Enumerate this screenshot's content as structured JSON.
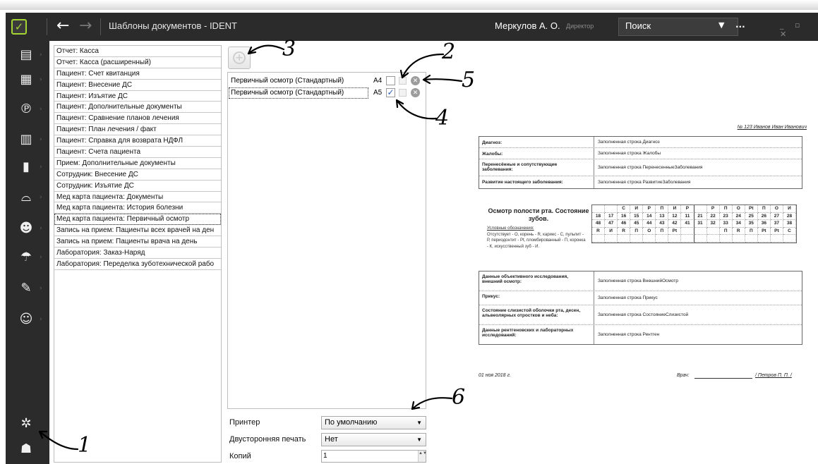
{
  "window": {
    "title": "Шаблоны документов - IDENT",
    "user_name": "Меркулов А. О.",
    "user_role": "Директор",
    "search_label": "Поиск",
    "search_more": "...",
    "logo_glyph": "✓",
    "back_glyph": "←",
    "forward_glyph": "→",
    "window_controls": "_ ▫ ✕"
  },
  "sidebar": {
    "items": [
      {
        "icon": "id-card-icon",
        "glyph": "▤"
      },
      {
        "icon": "calendar-icon",
        "glyph": "▦"
      },
      {
        "icon": "payment-icon",
        "glyph": "℗"
      },
      {
        "icon": "cash-register-icon",
        "glyph": "▥"
      },
      {
        "icon": "reports-chart-icon",
        "glyph": "▮"
      },
      {
        "icon": "tooth-icon",
        "glyph": "⌓"
      },
      {
        "icon": "users-icon",
        "glyph": "☻"
      },
      {
        "icon": "umbrella-icon",
        "glyph": "☂"
      },
      {
        "icon": "syringe-icon",
        "glyph": "✎"
      },
      {
        "icon": "patient-payment-icon",
        "glyph": "☺"
      }
    ],
    "settings_glyph": "✲",
    "profile_glyph": "☗"
  },
  "templates": [
    "Отчет: Касса",
    "Отчет: Касса (расширенный)",
    "Пациент: Счет квитанция",
    "Пациент: Внесение ДС",
    "Пациент: Изъятие ДС",
    "Пациент: Дополнительные документы",
    "Пациент: Сравнение планов лечения",
    "Пациент: План лечения / факт",
    "Пациент: Справка для возврата НДФЛ",
    "Пациент: Счета пациента",
    "Прием: Дополнительные документы",
    "Сотрудник: Внесение ДС",
    "Сотрудник: Изъятие ДС",
    "Мед карта пациента: Документы",
    "Мед карта пациента: История болезни",
    "Мед карта пациента: Первичный осмотр",
    "Запись на прием: Пациенты всех врачей на ден",
    "Запись на прием: Пациенты врача на день",
    "Лаборатория: Заказ-Наряд",
    "Лаборатория: Переделка зуботехнической рабо"
  ],
  "selected_template_index": 15,
  "add_icon_glyph": "+",
  "forms": [
    {
      "name": "Первичный осмотр (Стандартный)",
      "size": "A4",
      "checked": false,
      "check_glyph": "",
      "delete_glyph": "✕"
    },
    {
      "name": "Первичный осмотр (Стандартный)",
      "size": "A5",
      "checked": true,
      "check_glyph": "✓",
      "delete_glyph": "✕"
    }
  ],
  "options": {
    "printer_label": "Принтер",
    "printer_value": "По умолчанию",
    "duplex_label": "Двусторонняя печать",
    "duplex_value": "Нет",
    "copies_label": "Копий",
    "copies_value": "1",
    "arrow_glyph": "▼",
    "spin_glyph": "▲▼"
  },
  "annotations": [
    "1",
    "2",
    "3",
    "4",
    "5",
    "6"
  ],
  "preview": {
    "patient": "№ 123 Иванов Иван Иванович",
    "section1": [
      {
        "k": "Диагноз:",
        "v": "Заполненная строка Диагноз"
      },
      {
        "k": "Жалобы:",
        "v": "Заполненная строка Жалобы"
      },
      {
        "k": "Перенесённые и сопутствующие заболевания:",
        "v": "Заполненная строка ПеренесенныеЗаболевания"
      },
      {
        "k": "Развитие настоящего заболевания:",
        "v": "Заполненная строка РазвитиеЗаболевания"
      }
    ],
    "teeth_title": "Осмотр полости рта. Состояние зубов.",
    "teeth_legend_title": "Условные обозначения:",
    "teeth_legend": "Отсутствует - О, корень - R, кариес - С, пульпит - Р, периодонтит - Pt, пломбированный - П, коронка - К, искусственный зуб - И.",
    "teeth_rows": [
      [
        "",
        "",
        "С",
        "И",
        "Р",
        "П",
        "И",
        "Р",
        "",
        "Р",
        "П",
        "О",
        "Pt",
        "П",
        "О",
        "И"
      ],
      [
        "18",
        "17",
        "16",
        "15",
        "14",
        "13",
        "12",
        "11",
        "21",
        "22",
        "23",
        "24",
        "25",
        "26",
        "27",
        "28"
      ],
      [
        "48",
        "47",
        "46",
        "45",
        "44",
        "43",
        "42",
        "41",
        "31",
        "32",
        "33",
        "34",
        "35",
        "36",
        "37",
        "38"
      ],
      [
        "R",
        "И",
        "R",
        "П",
        "О",
        "П",
        "Pt",
        "",
        "",
        "",
        "П",
        "R",
        "П",
        "Pt",
        "Pt",
        "С"
      ],
      [
        "",
        "",
        "",
        "",
        "",
        "",
        "",
        "",
        "",
        "",
        "",
        "",
        "",
        "",
        "",
        ""
      ]
    ],
    "section2": [
      {
        "k": "Данные объективного исследования, внешний осмотр:",
        "v": "Заполненная строка ВнешнийОсмотр"
      },
      {
        "k": "Прикус:",
        "v": "Заполненная строка Прикус"
      },
      {
        "k": "Состояние слизистой оболочки рта, десен, альвеолярных отростков и неба:",
        "v": "Заполненная строка СостояниеСлизистой"
      },
      {
        "k": "Данные рентгеновских и лабораторных исследований:",
        "v": "Заполненная строка Рентген"
      }
    ],
    "date": "01 ноя 2018 г.",
    "doctor_label": "Врач:",
    "doctor_name": "Петров П. П.",
    "doctor_prefix": "/ ",
    "doctor_suffix": " /"
  }
}
